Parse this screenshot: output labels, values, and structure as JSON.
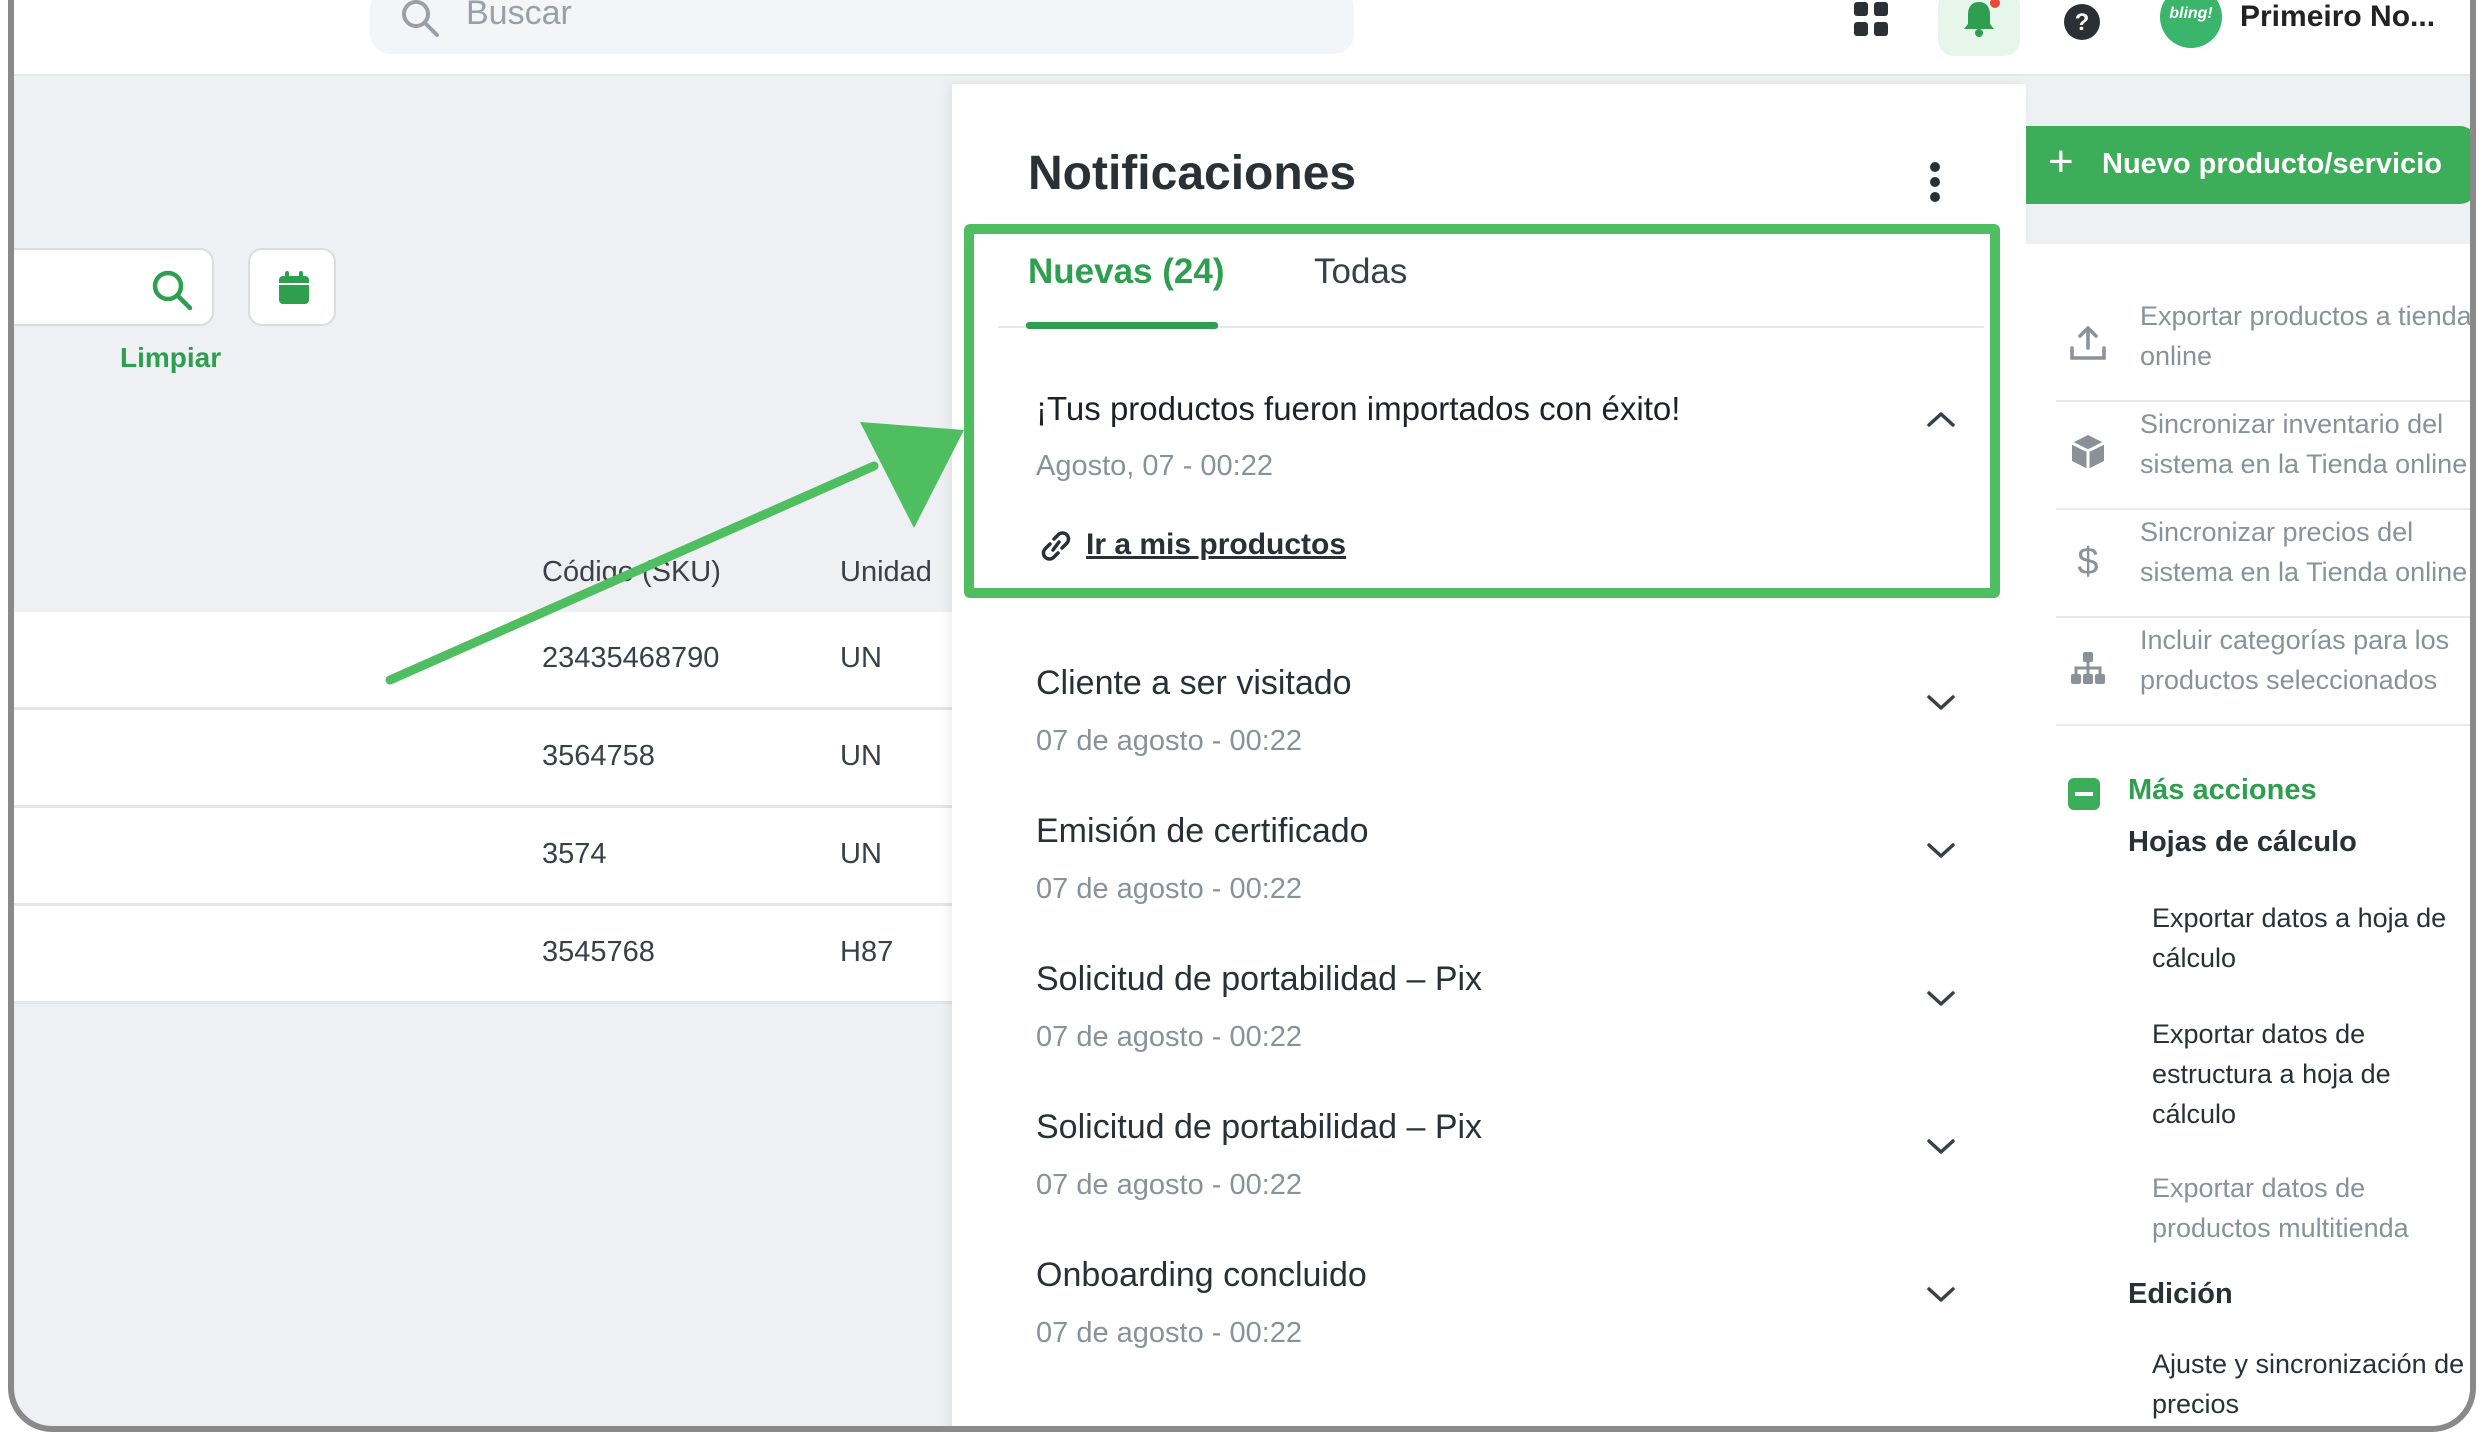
{
  "topbar": {
    "search_placeholder": "Buscar",
    "user_name": "Primeiro No...",
    "avatar_text": "bling!"
  },
  "filters": {
    "clear_label": "Limpiar"
  },
  "table": {
    "columns": [
      "Código (SKU)",
      "Unidad"
    ],
    "rows": [
      {
        "sku": "23435468790",
        "unit": "UN"
      },
      {
        "sku": "3564758",
        "unit": "UN"
      },
      {
        "sku": "3574",
        "unit": "UN"
      },
      {
        "sku": "3545768",
        "unit": "H87"
      }
    ]
  },
  "notifications": {
    "title": "Notificaciones",
    "tabs": [
      {
        "label": "Nuevas (24)",
        "active": true
      },
      {
        "label": "Todas",
        "active": false
      }
    ],
    "items": [
      {
        "title": "¡Tus productos fueron importados con éxito!",
        "date": "Agosto, 07 - 00:22",
        "link": "Ir a mis productos",
        "expanded": true
      },
      {
        "title": "Cliente a ser visitado",
        "date": "07 de agosto - 00:22"
      },
      {
        "title": "Emisión de certificado",
        "date": "07 de agosto - 00:22"
      },
      {
        "title": "Solicitud de portabilidad – Pix",
        "date": "07 de agosto - 00:22"
      },
      {
        "title": "Solicitud de portabilidad – Pix",
        "date": "07 de agosto - 00:22"
      },
      {
        "title": "Onboarding concluido",
        "date": "07 de agosto - 00:22"
      }
    ]
  },
  "new_product_button": "Nuevo producto/servicio",
  "sidebar": {
    "actions": [
      {
        "label": "Exportar productos a tienda online",
        "icon": "upload-icon"
      },
      {
        "label": "Sincronizar inventario del sistema en la Tienda online",
        "icon": "box-icon"
      },
      {
        "label": "Sincronizar precios del sistema en la Tienda online",
        "icon": "dollar-icon"
      },
      {
        "label": "Incluir categorías para los productos seleccionados",
        "icon": "hierarchy-icon"
      }
    ],
    "more_actions": "Más acciones",
    "spreadsheets_heading": "Hojas de cálculo",
    "spreadsheet_links": [
      "Exportar datos a hoja de cálculo",
      "Exportar datos de estructura a hoja de cálculo",
      "Exportar datos de productos multitienda"
    ],
    "edition_heading": "Edición",
    "edition_links": [
      "Ajuste y sincronización de precios"
    ]
  },
  "colors": {
    "accent_green": "#2e9e4f",
    "highlight_green": "#4fbe60",
    "button_green": "#3cad58",
    "notification_dot": "#e44b3a"
  }
}
